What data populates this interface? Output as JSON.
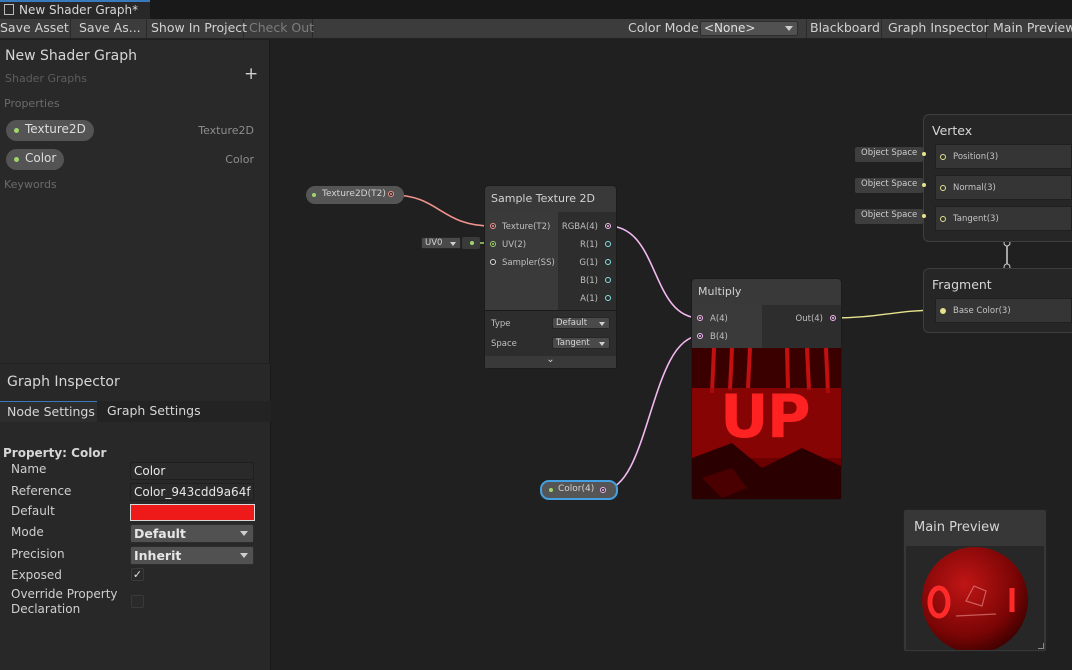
{
  "window": {
    "tab_title": "New Shader Graph*"
  },
  "toolbar": {
    "save_asset": "Save Asset",
    "save_as": "Save As...",
    "show_in_project": "Show In Project",
    "check_out": "Check Out",
    "color_mode_label": "Color Mode",
    "color_mode_value": "<None>",
    "blackboard": "Blackboard",
    "graph_inspector": "Graph Inspector",
    "main_preview": "Main Preview"
  },
  "blackboard": {
    "title": "New Shader Graph",
    "subtitle": "Shader Graphs",
    "add_symbol": "+",
    "properties_label": "Properties",
    "properties": [
      {
        "name": "Texture2D",
        "type": "Texture2D"
      },
      {
        "name": "Color",
        "type": "Color"
      }
    ],
    "keywords_label": "Keywords"
  },
  "inspector": {
    "title": "Graph Inspector",
    "tabs": [
      "Node Settings",
      "Graph Settings"
    ],
    "property_title": "Property: Color",
    "fields": {
      "name_label": "Name",
      "name_value": "Color",
      "reference_label": "Reference",
      "reference_value": "Color_943cdd9a64f",
      "default_label": "Default",
      "default_color": "#ee1a1a",
      "mode_label": "Mode",
      "mode_value": "Default",
      "precision_label": "Precision",
      "precision_value": "Inherit",
      "exposed_label": "Exposed",
      "exposed_checked": "✓",
      "override_label_1": "Override Property",
      "override_label_2": "Declaration"
    }
  },
  "graph": {
    "texture_prop_node": "Texture2D(T2)",
    "uv_dropdown": "UV0",
    "sample_texture": {
      "title": "Sample Texture 2D",
      "inputs": [
        "Texture(T2)",
        "UV(2)",
        "Sampler(SS)"
      ],
      "outputs": [
        "RGBA(4)",
        "R(1)",
        "G(1)",
        "B(1)",
        "A(1)"
      ],
      "type_label": "Type",
      "type_value": "Default",
      "space_label": "Space",
      "space_value": "Tangent",
      "collapse_symbol": "⌄"
    },
    "multiply": {
      "title": "Multiply",
      "inputs": [
        "A(4)",
        "B(4)"
      ],
      "output": "Out(4)",
      "preview_text": "UP"
    },
    "color_prop_node": "Color(4)",
    "vertex": {
      "title": "Vertex",
      "blocks": [
        "Position(3)",
        "Normal(3)",
        "Tangent(3)"
      ],
      "space_tags": [
        "Object Space",
        "Object Space",
        "Object Space"
      ]
    },
    "fragment": {
      "title": "Fragment",
      "blocks": [
        "Base Color(3)"
      ]
    },
    "colors": {
      "texture_port": "#f0938f",
      "vector_port": "#f3b8f0",
      "uv_port": "#9fd46e",
      "float_port": "#84e4e7",
      "vector3_port": "#e6e38f",
      "selection": "#44a0e0"
    }
  },
  "main_preview": {
    "title": "Main Preview"
  }
}
